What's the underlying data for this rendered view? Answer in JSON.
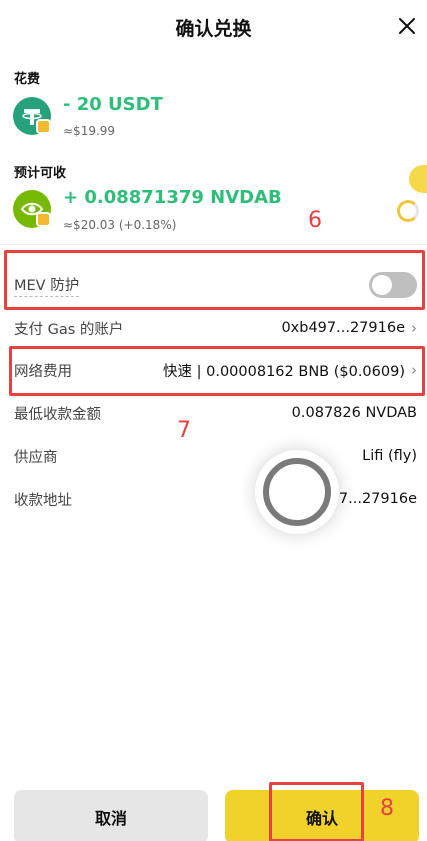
{
  "header": {
    "title": "确认兑换",
    "close_icon": "close-icon"
  },
  "spend": {
    "label": "花费",
    "amount": "- 20 USDT",
    "fiat": "≈$19.99",
    "icon": "usdt-icon",
    "colors": {
      "icon_bg": "#26a17b"
    }
  },
  "receive": {
    "label": "预计可收",
    "amount": "+ 0.08871379 NVDAB",
    "fiat": "≈$20.03 (+0.18%)",
    "icon": "nvidia-icon",
    "colors": {
      "icon_bg": "#76b900"
    }
  },
  "details": {
    "mev": {
      "label": "MEV 防护",
      "enabled": false
    },
    "gas_account": {
      "label": "支付 Gas 的账户",
      "value": "0xb497...27916e"
    },
    "network_fee": {
      "label": "网络费用",
      "value": "快速 | 0.00008162 BNB ($0.0609)"
    },
    "min_receive": {
      "label": "最低收款金额",
      "value": "0.087826 NVDAB"
    },
    "provider": {
      "label": "供应商",
      "value": "Lifi (fly)"
    },
    "recipient": {
      "label": "收款地址",
      "value": "07...27916e"
    }
  },
  "annotations": {
    "a6": "6",
    "a7": "7",
    "a8": "8"
  },
  "buttons": {
    "cancel": "取消",
    "confirm": "确认"
  },
  "colors": {
    "accent": "#f0d22a",
    "positive": "#2fbd7a",
    "annotation": "#e84141"
  }
}
